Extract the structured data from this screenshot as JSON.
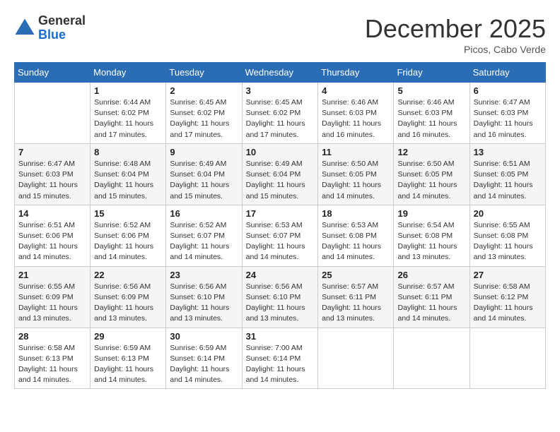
{
  "logo": {
    "general": "General",
    "blue": "Blue"
  },
  "title": {
    "month": "December 2025",
    "location": "Picos, Cabo Verde"
  },
  "calendar": {
    "headers": [
      "Sunday",
      "Monday",
      "Tuesday",
      "Wednesday",
      "Thursday",
      "Friday",
      "Saturday"
    ],
    "weeks": [
      [
        {
          "day": "",
          "info": ""
        },
        {
          "day": "1",
          "info": "Sunrise: 6:44 AM\nSunset: 6:02 PM\nDaylight: 11 hours and 17 minutes."
        },
        {
          "day": "2",
          "info": "Sunrise: 6:45 AM\nSunset: 6:02 PM\nDaylight: 11 hours and 17 minutes."
        },
        {
          "day": "3",
          "info": "Sunrise: 6:45 AM\nSunset: 6:02 PM\nDaylight: 11 hours and 17 minutes."
        },
        {
          "day": "4",
          "info": "Sunrise: 6:46 AM\nSunset: 6:03 PM\nDaylight: 11 hours and 16 minutes."
        },
        {
          "day": "5",
          "info": "Sunrise: 6:46 AM\nSunset: 6:03 PM\nDaylight: 11 hours and 16 minutes."
        },
        {
          "day": "6",
          "info": "Sunrise: 6:47 AM\nSunset: 6:03 PM\nDaylight: 11 hours and 16 minutes."
        }
      ],
      [
        {
          "day": "7",
          "info": "Sunrise: 6:47 AM\nSunset: 6:03 PM\nDaylight: 11 hours and 15 minutes."
        },
        {
          "day": "8",
          "info": "Sunrise: 6:48 AM\nSunset: 6:04 PM\nDaylight: 11 hours and 15 minutes."
        },
        {
          "day": "9",
          "info": "Sunrise: 6:49 AM\nSunset: 6:04 PM\nDaylight: 11 hours and 15 minutes."
        },
        {
          "day": "10",
          "info": "Sunrise: 6:49 AM\nSunset: 6:04 PM\nDaylight: 11 hours and 15 minutes."
        },
        {
          "day": "11",
          "info": "Sunrise: 6:50 AM\nSunset: 6:05 PM\nDaylight: 11 hours and 14 minutes."
        },
        {
          "day": "12",
          "info": "Sunrise: 6:50 AM\nSunset: 6:05 PM\nDaylight: 11 hours and 14 minutes."
        },
        {
          "day": "13",
          "info": "Sunrise: 6:51 AM\nSunset: 6:05 PM\nDaylight: 11 hours and 14 minutes."
        }
      ],
      [
        {
          "day": "14",
          "info": "Sunrise: 6:51 AM\nSunset: 6:06 PM\nDaylight: 11 hours and 14 minutes."
        },
        {
          "day": "15",
          "info": "Sunrise: 6:52 AM\nSunset: 6:06 PM\nDaylight: 11 hours and 14 minutes."
        },
        {
          "day": "16",
          "info": "Sunrise: 6:52 AM\nSunset: 6:07 PM\nDaylight: 11 hours and 14 minutes."
        },
        {
          "day": "17",
          "info": "Sunrise: 6:53 AM\nSunset: 6:07 PM\nDaylight: 11 hours and 14 minutes."
        },
        {
          "day": "18",
          "info": "Sunrise: 6:53 AM\nSunset: 6:08 PM\nDaylight: 11 hours and 14 minutes."
        },
        {
          "day": "19",
          "info": "Sunrise: 6:54 AM\nSunset: 6:08 PM\nDaylight: 11 hours and 13 minutes."
        },
        {
          "day": "20",
          "info": "Sunrise: 6:55 AM\nSunset: 6:08 PM\nDaylight: 11 hours and 13 minutes."
        }
      ],
      [
        {
          "day": "21",
          "info": "Sunrise: 6:55 AM\nSunset: 6:09 PM\nDaylight: 11 hours and 13 minutes."
        },
        {
          "day": "22",
          "info": "Sunrise: 6:56 AM\nSunset: 6:09 PM\nDaylight: 11 hours and 13 minutes."
        },
        {
          "day": "23",
          "info": "Sunrise: 6:56 AM\nSunset: 6:10 PM\nDaylight: 11 hours and 13 minutes."
        },
        {
          "day": "24",
          "info": "Sunrise: 6:56 AM\nSunset: 6:10 PM\nDaylight: 11 hours and 13 minutes."
        },
        {
          "day": "25",
          "info": "Sunrise: 6:57 AM\nSunset: 6:11 PM\nDaylight: 11 hours and 13 minutes."
        },
        {
          "day": "26",
          "info": "Sunrise: 6:57 AM\nSunset: 6:11 PM\nDaylight: 11 hours and 14 minutes."
        },
        {
          "day": "27",
          "info": "Sunrise: 6:58 AM\nSunset: 6:12 PM\nDaylight: 11 hours and 14 minutes."
        }
      ],
      [
        {
          "day": "28",
          "info": "Sunrise: 6:58 AM\nSunset: 6:13 PM\nDaylight: 11 hours and 14 minutes."
        },
        {
          "day": "29",
          "info": "Sunrise: 6:59 AM\nSunset: 6:13 PM\nDaylight: 11 hours and 14 minutes."
        },
        {
          "day": "30",
          "info": "Sunrise: 6:59 AM\nSunset: 6:14 PM\nDaylight: 11 hours and 14 minutes."
        },
        {
          "day": "31",
          "info": "Sunrise: 7:00 AM\nSunset: 6:14 PM\nDaylight: 11 hours and 14 minutes."
        },
        {
          "day": "",
          "info": ""
        },
        {
          "day": "",
          "info": ""
        },
        {
          "day": "",
          "info": ""
        }
      ]
    ]
  }
}
